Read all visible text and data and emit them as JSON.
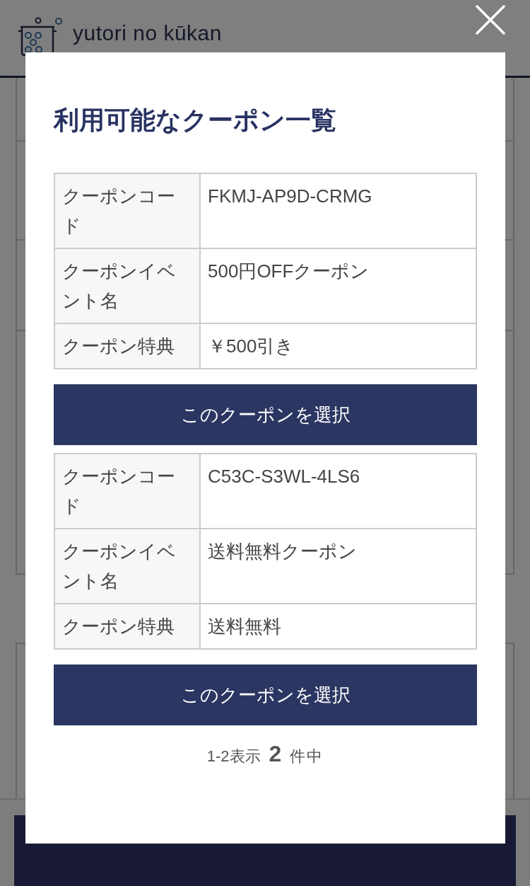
{
  "header": {
    "logo_text": "yutori no kūkan"
  },
  "modal": {
    "title": "利用可能なクーポン一覧",
    "coupons": [
      {
        "rows": [
          {
            "label": "クーポンコード",
            "value": "FKMJ-AP9D-CRMG"
          },
          {
            "label": "クーポンイベント名",
            "value": "500円OFFクーポン"
          },
          {
            "label": "クーポン特典",
            "value": "￥500引き"
          }
        ],
        "button": "このクーポンを選択"
      },
      {
        "rows": [
          {
            "label": "クーポンコード",
            "value": "C53C-S3WL-4LS6"
          },
          {
            "label": "クーポンイベント名",
            "value": "送料無料クーポン"
          },
          {
            "label": "クーポン特典",
            "value": "送料無料"
          }
        ],
        "button": "このクーポンを選択"
      }
    ],
    "pagination": {
      "range": "1-2表示",
      "total": "2",
      "suffix": "件中"
    }
  }
}
